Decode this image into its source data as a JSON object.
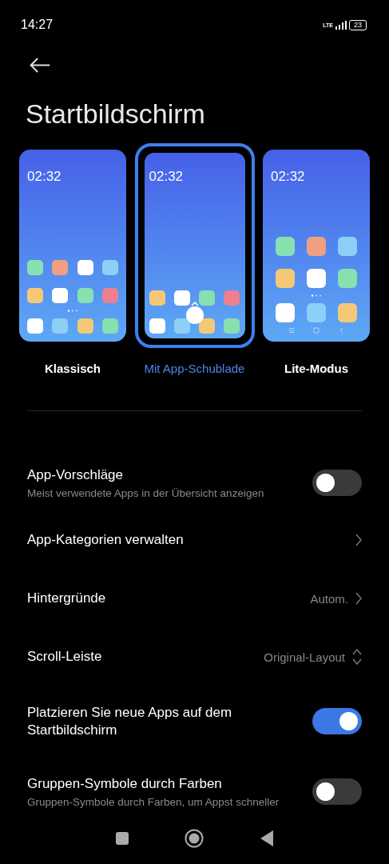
{
  "status_bar": {
    "time": "14:27",
    "network": "LTE",
    "battery": "23"
  },
  "title": "Startbildschirm",
  "layouts": [
    {
      "kind": "classic",
      "clock": "02:32",
      "label": "Klassisch",
      "selected": false
    },
    {
      "kind": "drawer",
      "clock": "02:32",
      "label": "Mit App-Schublade",
      "selected": true
    },
    {
      "kind": "lite",
      "clock": "02:32",
      "label": "Lite-Modus",
      "selected": false
    }
  ],
  "settings": [
    {
      "kind": "toggle",
      "label": "App-Vorschläge",
      "subtitle": "Meist verwendete Apps in der Übersicht anzeigen",
      "on": false
    },
    {
      "kind": "link",
      "label": "App-Kategorien verwalten"
    },
    {
      "kind": "link",
      "label": "Hintergründe",
      "value": "Autom."
    },
    {
      "kind": "select",
      "label": "Scroll-Leiste",
      "value": "Original-Layout"
    },
    {
      "kind": "toggle",
      "label": "Platzieren Sie neue Apps auf dem Startbildschirm",
      "on": true
    },
    {
      "kind": "toggle",
      "label": "Gruppen-Symbole durch Farben",
      "subtitle": "Gruppen-Symbole durch Farben, um Appst schneller",
      "on": false
    }
  ]
}
